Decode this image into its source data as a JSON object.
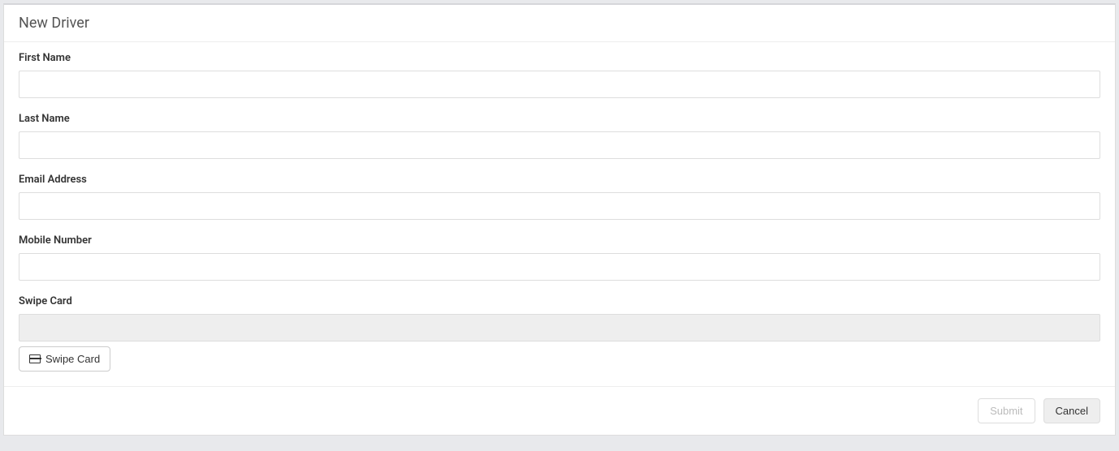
{
  "header": {
    "title": "New Driver"
  },
  "form": {
    "first_name": {
      "label": "First Name",
      "value": ""
    },
    "last_name": {
      "label": "Last Name",
      "value": ""
    },
    "email": {
      "label": "Email Address",
      "value": ""
    },
    "mobile": {
      "label": "Mobile Number",
      "value": ""
    },
    "swipe_card": {
      "label": "Swipe Card",
      "value": "",
      "button_label": "Swipe Card"
    }
  },
  "footer": {
    "submit_label": "Submit",
    "cancel_label": "Cancel"
  }
}
